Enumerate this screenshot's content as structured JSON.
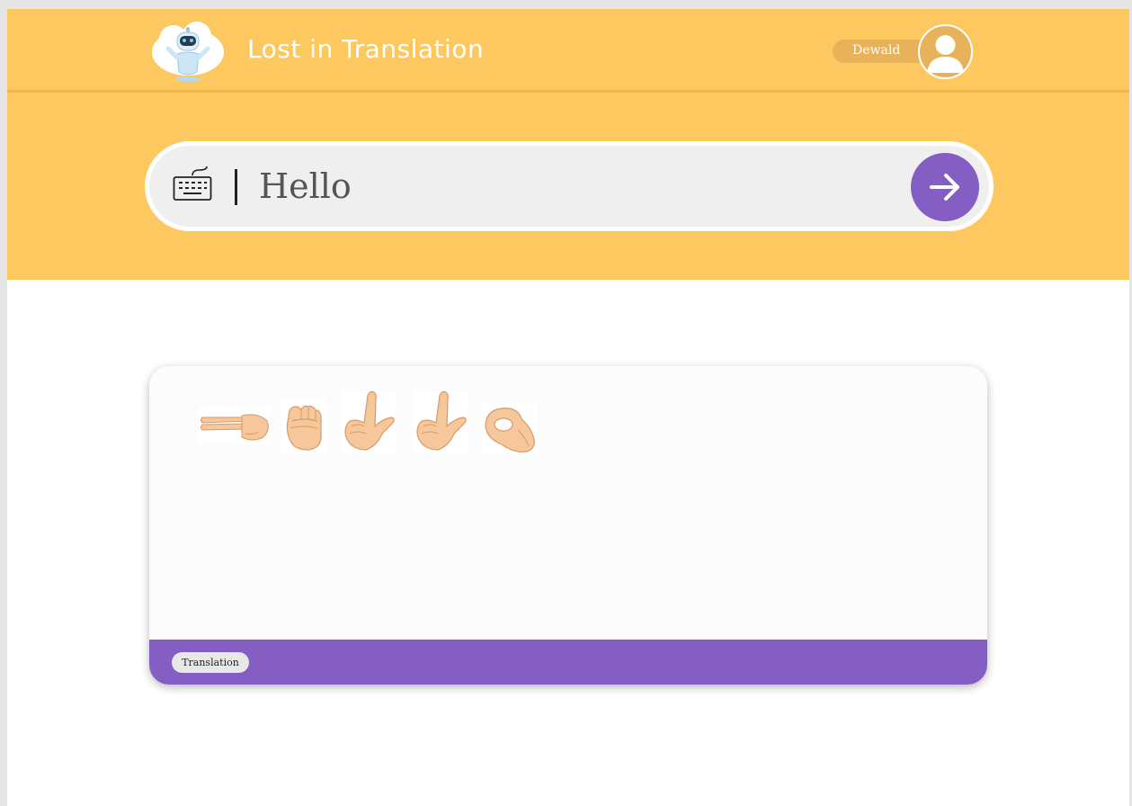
{
  "header": {
    "app_title": "Lost in Translation",
    "logo_icon": "robot-logo-icon",
    "user": {
      "name": "Dewald",
      "avatar_icon": "user-avatar-icon"
    }
  },
  "translator": {
    "input_icon": "keyboard-icon",
    "input_value": "Hello",
    "submit_icon": "arrow-right-icon"
  },
  "output": {
    "signs": [
      {
        "letter": "h",
        "icon": "sign-h-icon"
      },
      {
        "letter": "e",
        "icon": "sign-e-icon"
      },
      {
        "letter": "l",
        "icon": "sign-l-icon"
      },
      {
        "letter": "l",
        "icon": "sign-l-icon"
      },
      {
        "letter": "o",
        "icon": "sign-o-icon"
      }
    ],
    "footer_label": "Translation"
  },
  "colors": {
    "header_bg": "#fec861",
    "accent_purple": "#845ec2",
    "user_pill": "#e7b25a"
  }
}
